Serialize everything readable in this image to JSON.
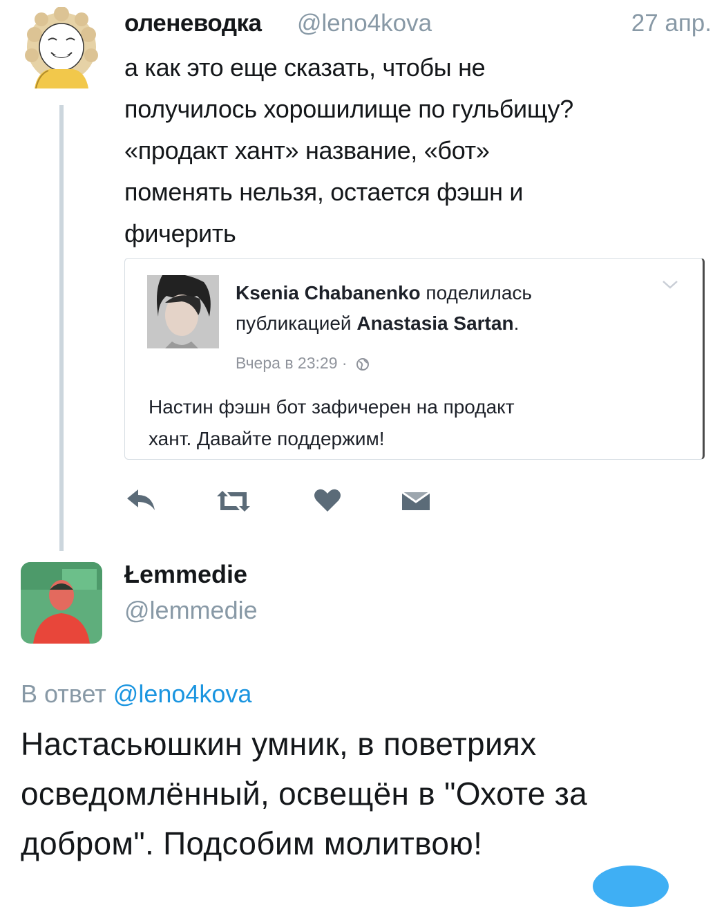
{
  "tweet1": {
    "name": "оленеводка",
    "handle": "@leno4kova",
    "date": "27 апр.",
    "text": "а как это еще сказать, чтобы не\nполучилось хорошилище по гульбищу?\n«продакт хант» название, «бот»\nпоменять нельзя, остается фэшн и\nфичерить"
  },
  "card": {
    "author": "Ksenia Chabanenko",
    "shared": " поделилась",
    "publication": "публикацией ",
    "original_author": "Anastasia Sartan",
    "period": ".",
    "time": "Вчера в 23:29 ·",
    "text": "Настин фэшн бот зафичерен на продакт\nхант. Давайте поддержим!"
  },
  "actions": {
    "reply_icon": "reply-icon",
    "retweet_icon": "retweet-icon",
    "like_icon": "heart-icon",
    "dm_icon": "envelope-icon"
  },
  "tweet2": {
    "name": "Łemmedie",
    "handle": "@lemmedie",
    "reply_prefix": "В ответ ",
    "reply_handle": "@leno4kova",
    "text": "Настасьюшкин умник, в поветриях\nосведомлённый, освещён в \"Охоте за\nдобром\". Подсобим молитвою!"
  },
  "colors": {
    "link": "#1b95e0",
    "muted": "#8899a6",
    "text": "#14171a",
    "thread_line": "#ccd6dd"
  }
}
